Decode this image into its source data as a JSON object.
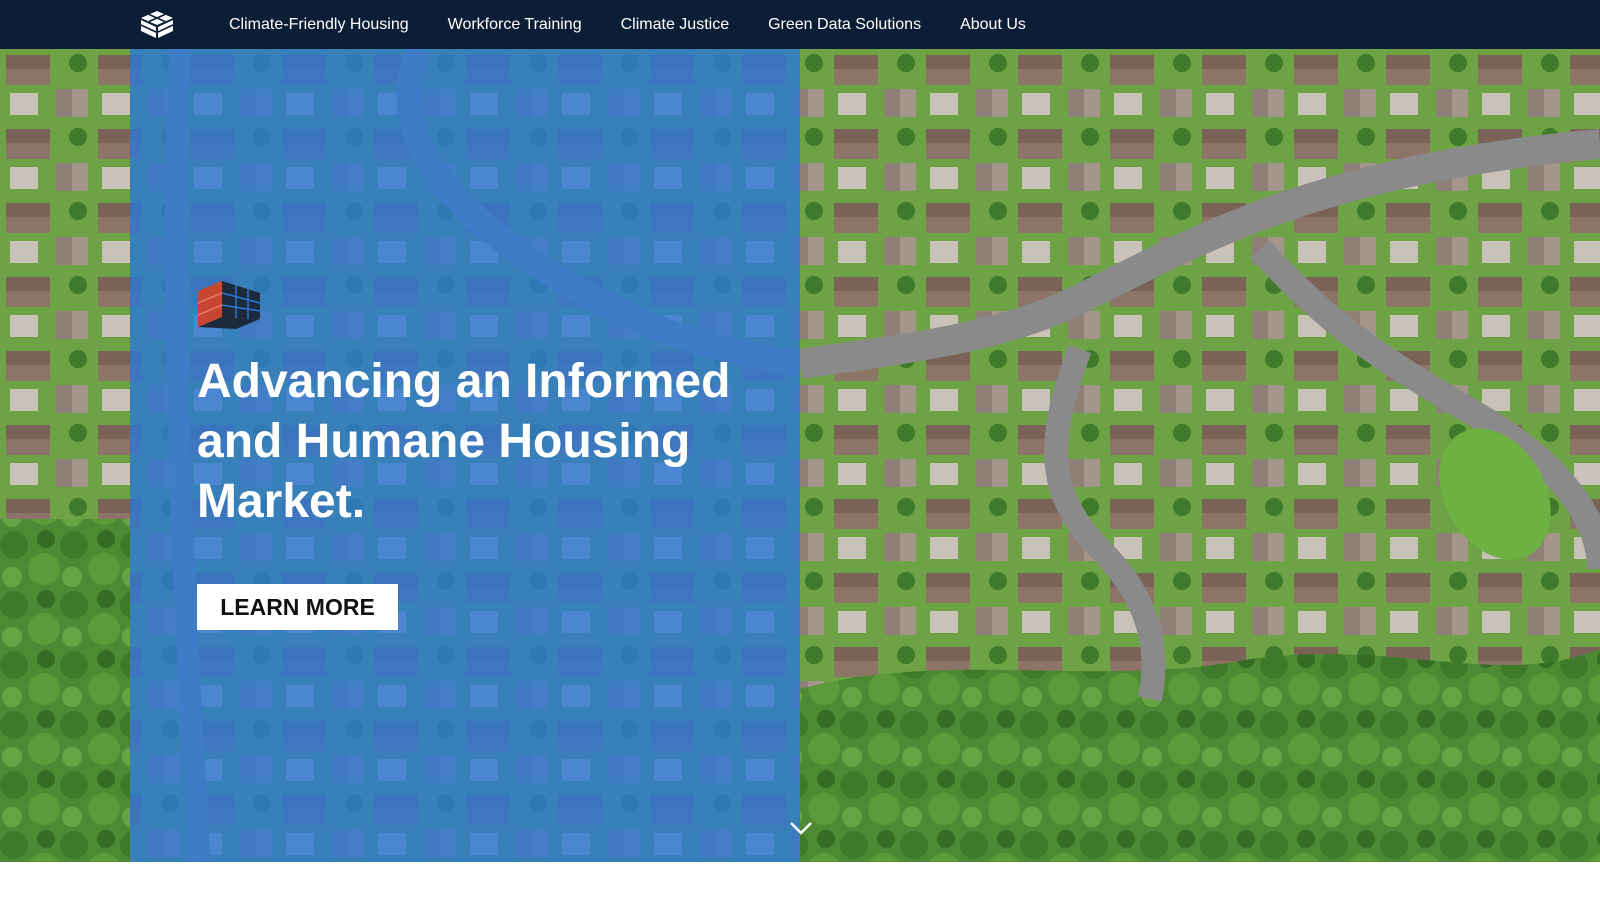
{
  "nav": {
    "logo_icon": "cube-logo-icon",
    "items": [
      {
        "label": "Climate-Friendly Housing"
      },
      {
        "label": "Workforce Training"
      },
      {
        "label": "Climate Justice"
      },
      {
        "label": "Green Data Solutions"
      },
      {
        "label": "About Us"
      }
    ]
  },
  "hero": {
    "mark_icon": "isometric-cube-icon",
    "title": "Advancing an Informed and Humane Housing Market.",
    "cta_label": "LEARN MORE",
    "scroll_icon": "chevron-down-icon",
    "background": "aerial-photo-of-suburban-houses"
  },
  "colors": {
    "nav_bg": "#0b1e36",
    "panel_blue": "#2a78d6",
    "mark_red": "#c8452f",
    "mark_dark": "#1d2a3a"
  }
}
